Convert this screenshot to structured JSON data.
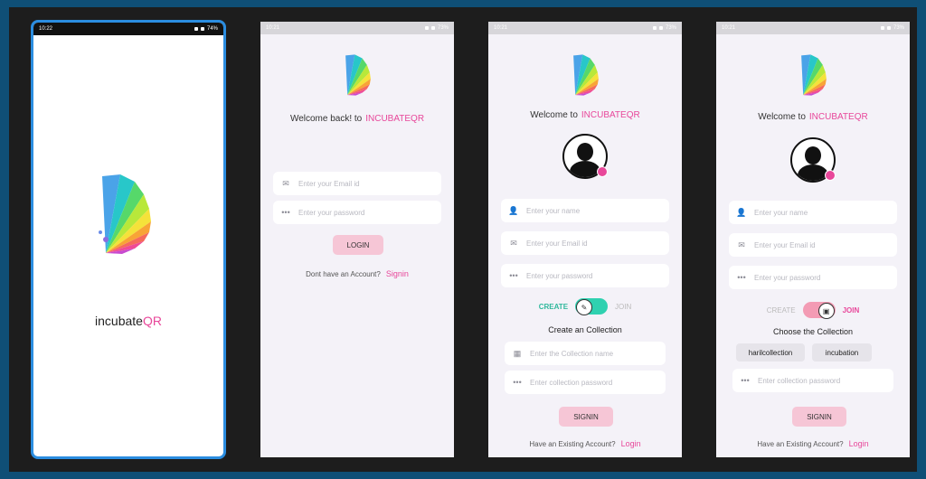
{
  "colors": {
    "brand_pink": "#e8479a",
    "toggle_green": "#2fd1b0",
    "toggle_pink": "#f39bb4",
    "button_pink": "#f6c6d6"
  },
  "splash": {
    "time": "10:22",
    "battery": "74%",
    "app_name_prefix": "incubate",
    "app_name_suffix": "QR"
  },
  "login": {
    "time": "10:21",
    "battery": "73%",
    "welcome": "Welcome back! to",
    "brand": "INCUBATEQR",
    "email_placeholder": "Enter your Email id",
    "password_placeholder": "Enter your password",
    "login_button": "LOGIN",
    "no_account_text": "Dont have an Account?",
    "signin_link": "Signin"
  },
  "signup_create": {
    "time": "10:21",
    "battery": "73%",
    "welcome": "Welcome to",
    "brand": "INCUBATEQR",
    "name_placeholder": "Enter your name",
    "email_placeholder": "Enter your Email id",
    "password_placeholder": "Enter your password",
    "toggle_left": "CREATE",
    "toggle_right": "JOIN",
    "section_title": "Create an Collection",
    "collection_name_placeholder": "Enter the Collection name",
    "collection_password_placeholder": "Enter collection password",
    "signin_button": "SIGNIN",
    "existing_text": "Have an Existing Account?",
    "login_link": "Login"
  },
  "signup_join": {
    "time": "10:21",
    "battery": "73%",
    "welcome": "Welcome to",
    "brand": "INCUBATEQR",
    "name_placeholder": "Enter your name",
    "email_placeholder": "Enter your Email id",
    "password_placeholder": "Enter your password",
    "toggle_left": "CREATE",
    "toggle_right": "JOIN",
    "section_title": "Choose the Collection",
    "collections": [
      "harilcollection",
      "incubation"
    ],
    "collection_password_placeholder": "Enter collection password",
    "signin_button": "SIGNIN",
    "existing_text": "Have an Existing Account?",
    "login_link": "Login"
  }
}
